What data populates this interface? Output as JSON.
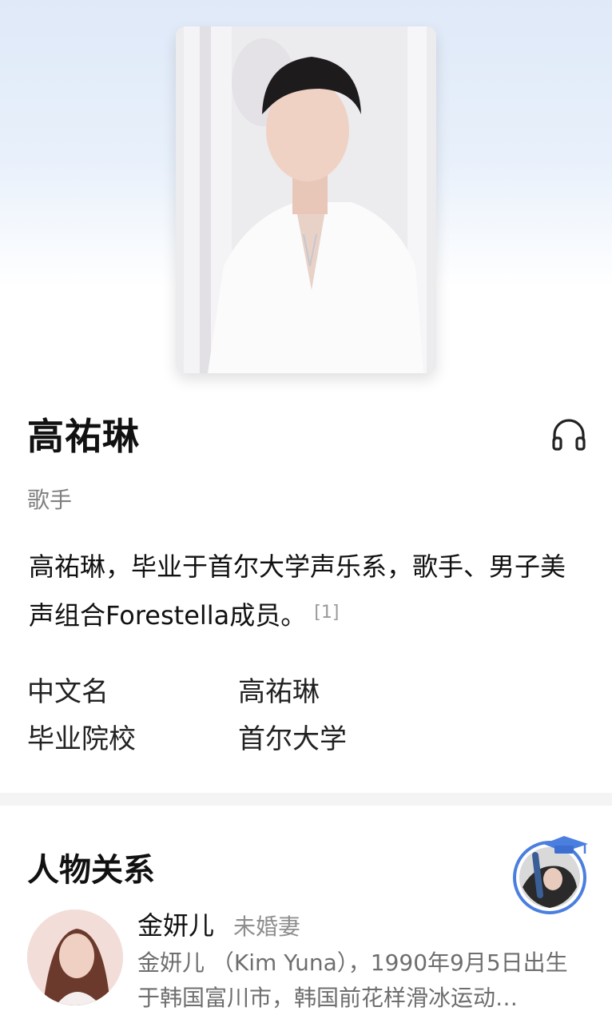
{
  "entry": {
    "name": "高祐琳",
    "occupation": "歌手",
    "summary": "高祐琳，毕业于首尔大学声乐系，歌手、男子美声组合Forestella成员。",
    "reference": "[1]",
    "info": [
      {
        "key": "中文名",
        "value": "高祐琳"
      },
      {
        "key": "毕业院校",
        "value": "首尔大学"
      }
    ]
  },
  "relations": {
    "title": "人物关系",
    "people": [
      {
        "name": "金妍儿",
        "relation": "未婚妻",
        "description": "金妍儿 （Kim Yuna），1990年9月5日出生于韩国富川市，韩国前花样滑冰运动…"
      }
    ]
  },
  "icons": {
    "audio": "headphones-icon",
    "badge": "graduation-cap-icon"
  },
  "colors": {
    "accent": "#4a7fe0",
    "muted": "#808080"
  }
}
